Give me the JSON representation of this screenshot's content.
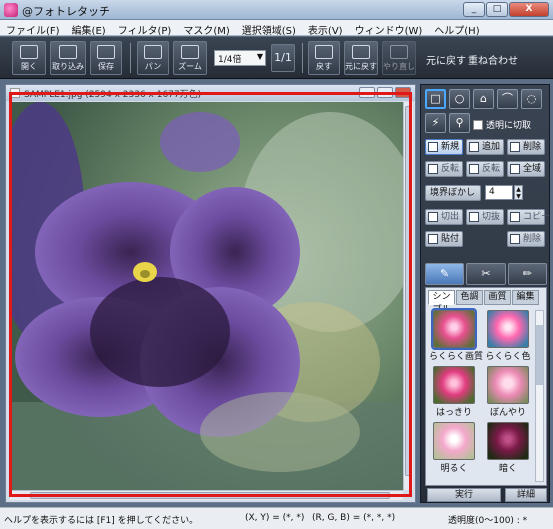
{
  "window": {
    "title": "@フォトレタッチ",
    "buttons": [
      "_",
      "□",
      "X"
    ]
  },
  "menu": [
    "ファイル(F)",
    "編集(E)",
    "フィルタ(P)",
    "マスク(M)",
    "選択領域(S)",
    "表示(V)",
    "ウィンドウ(W)",
    "ヘルプ(H)"
  ],
  "toolbar": {
    "buttons": [
      "開く",
      "取り込み",
      "保存",
      "パン",
      "ズーム",
      "戻す",
      "元に戻す",
      "やり直し"
    ],
    "zoom": "1/4倍",
    "actual_size": "1/1",
    "labels": [
      "元に戻す",
      "重ね合わせ"
    ]
  },
  "image_window": {
    "title": "SAMPLE1.jpg (2594 x 2336 x 1677万色)"
  },
  "panel": {
    "transparent_cut": "透明に切取",
    "mode_buttons": [
      "新規",
      "追加",
      "削除",
      "反転",
      "反転",
      "全域"
    ],
    "blur_label": "境界ぼかし",
    "blur_value": "4",
    "edit_buttons": [
      "切出",
      "切抜",
      "コピー",
      "貼付",
      "削除"
    ],
    "filter_tabs": [
      "シンプル",
      "色調",
      "画質",
      "編集"
    ],
    "filters": [
      "らくらく画質",
      "らくらく色",
      "はっきり",
      "ぼんやり",
      "明るく",
      "暗く"
    ],
    "run": "実行",
    "detail": "詳細"
  },
  "status": {
    "help": "ヘルプを表示するには [F1] を押してください。",
    "coords": "(X, Y) = (*, *)",
    "rgb": "(R, G, B) = (*, *, *)",
    "opacity": "透明度(0〜100) : *"
  }
}
